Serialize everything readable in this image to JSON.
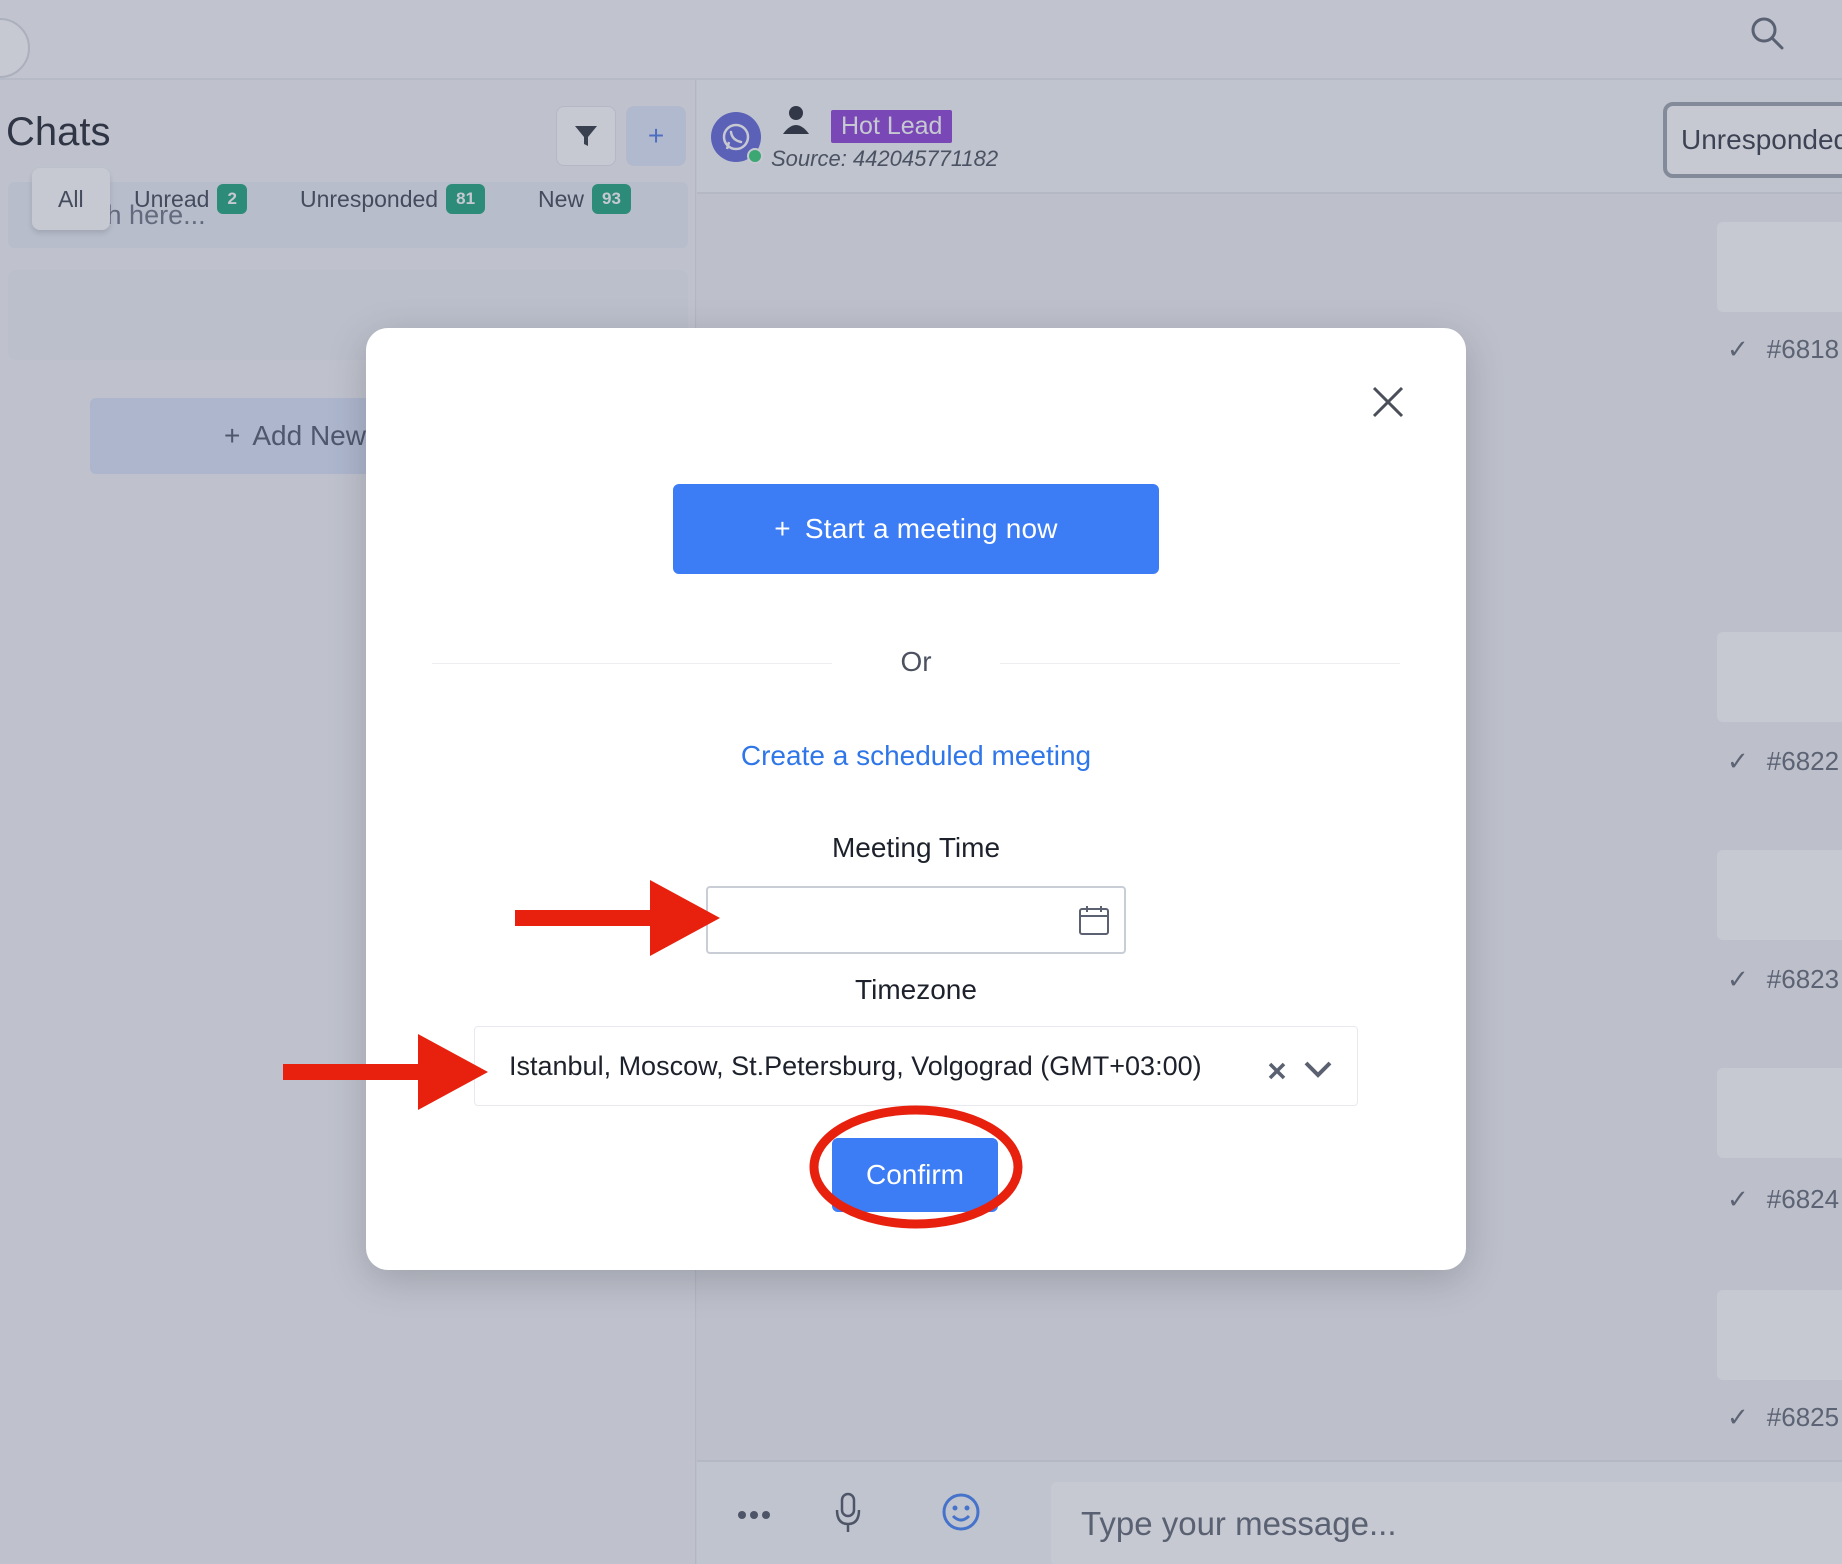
{
  "colors": {
    "primary": "#3c7cf5",
    "badge": "#18a27a",
    "hot_lead": "#8a3bd6",
    "annotation": "#e8210e"
  },
  "sidebar": {
    "title": "Chats",
    "search_placeholder": "Search here...",
    "tabs": [
      {
        "label": "All",
        "count": null
      },
      {
        "label": "Unread",
        "count": "2"
      },
      {
        "label": "Unresponded",
        "count": "81"
      },
      {
        "label": "New",
        "count": "93"
      }
    ],
    "add_new_label": "Add New"
  },
  "chat_header": {
    "tag": "Hot Lead",
    "source": "Source: 442045771182",
    "status_button": "Unresponded"
  },
  "messages": [
    {
      "id": "#6818"
    },
    {
      "id": "#6822"
    },
    {
      "id": "#6823"
    },
    {
      "id": "#6824"
    },
    {
      "id": "#6825"
    }
  ],
  "composer": {
    "placeholder": "Type your message..."
  },
  "modal": {
    "start_button": "Start a meeting now",
    "or_text": "Or",
    "scheduled_link": "Create a scheduled meeting",
    "meeting_time_label": "Meeting Time",
    "meeting_time_value": "",
    "timezone_label": "Timezone",
    "timezone_value": "Istanbul, Moscow, St.Petersburg, Volgograd (GMT+03:00)",
    "confirm_button": "Confirm"
  }
}
